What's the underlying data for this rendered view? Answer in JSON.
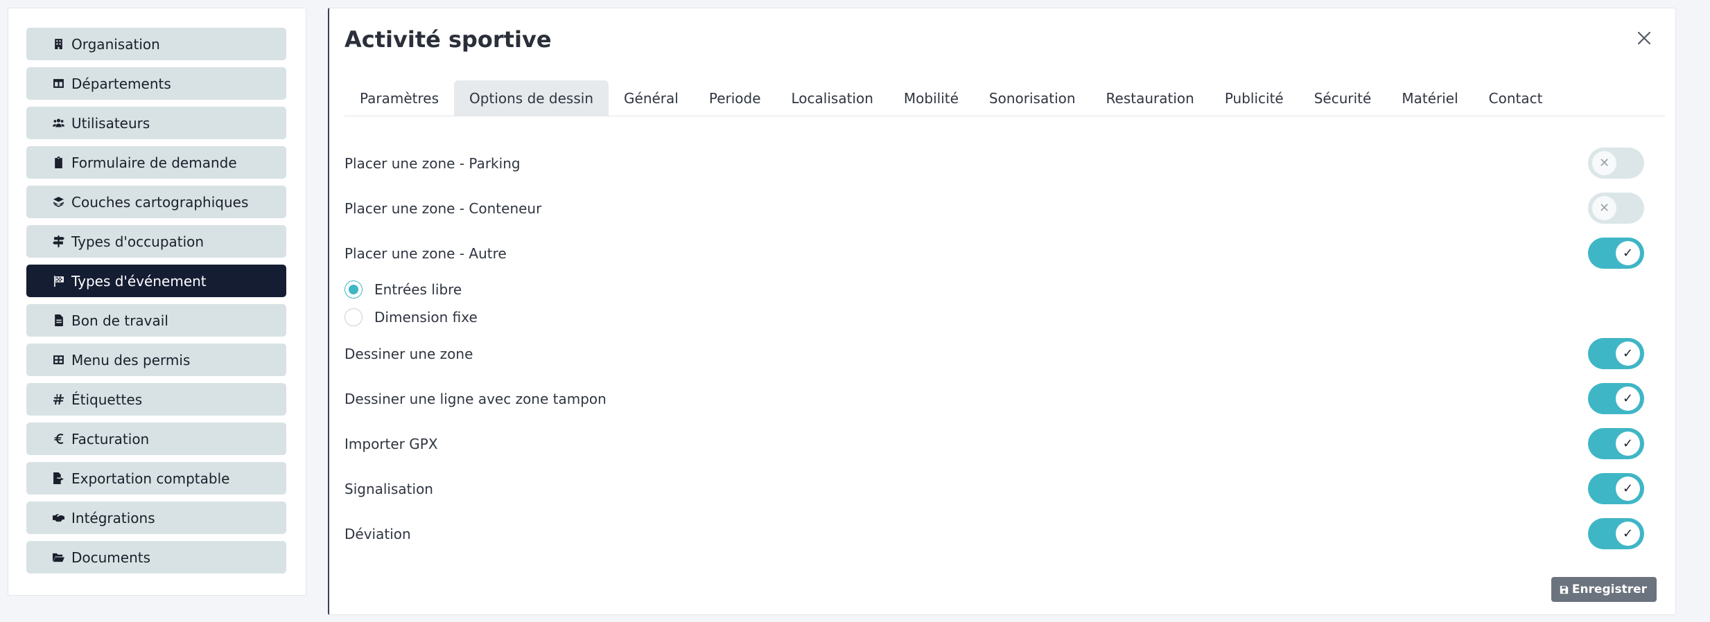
{
  "sidebar": {
    "items": [
      {
        "label": "Organisation",
        "icon": "building-icon"
      },
      {
        "label": "Départements",
        "icon": "table-icon"
      },
      {
        "label": "Utilisateurs",
        "icon": "users-icon"
      },
      {
        "label": "Formulaire de demande",
        "icon": "clipboard-icon"
      },
      {
        "label": "Couches cartographiques",
        "icon": "layers-icon"
      },
      {
        "label": "Types d'occupation",
        "icon": "signpost-icon"
      },
      {
        "label": "Types d'événement",
        "icon": "flag-checkered-icon",
        "active": true
      },
      {
        "label": "Bon de travail",
        "icon": "file-icon"
      },
      {
        "label": "Menu des permis",
        "icon": "grid-icon"
      },
      {
        "label": "Étiquettes",
        "icon": "hashtag-icon"
      },
      {
        "label": "Facturation",
        "icon": "euro-icon"
      },
      {
        "label": "Exportation comptable",
        "icon": "file-export-icon"
      },
      {
        "label": "Intégrations",
        "icon": "handshake-icon"
      },
      {
        "label": "Documents",
        "icon": "folder-open-icon"
      }
    ]
  },
  "panel": {
    "title": "Activité sportive",
    "tabs": [
      "Paramètres",
      "Options de dessin",
      "Général",
      "Periode",
      "Localisation",
      "Mobilité",
      "Sonorisation",
      "Restauration",
      "Publicité",
      "Sécurité",
      "Matériel",
      "Contact"
    ],
    "active_tab": "Options de dessin",
    "options": [
      {
        "label": "Placer une zone - Parking",
        "on": false
      },
      {
        "label": "Placer une zone - Conteneur",
        "on": false
      },
      {
        "label": "Placer une zone - Autre",
        "on": true
      }
    ],
    "radios": [
      {
        "label": "Entrées libre",
        "checked": true
      },
      {
        "label": "Dimension fixe",
        "checked": false
      }
    ],
    "options2": [
      {
        "label": "Dessiner une zone",
        "on": true
      },
      {
        "label": "Dessiner une ligne avec zone tampon",
        "on": true
      },
      {
        "label": "Importer GPX",
        "on": true
      },
      {
        "label": "Signalisation",
        "on": true
      },
      {
        "label": "Déviation",
        "on": true
      }
    ],
    "save_label": "Enregistrer"
  },
  "colors": {
    "accent": "#3fb6c6",
    "sidebar_active": "#151d33",
    "sidebar_item": "#d8e2e4",
    "save_button": "#6b737e"
  }
}
